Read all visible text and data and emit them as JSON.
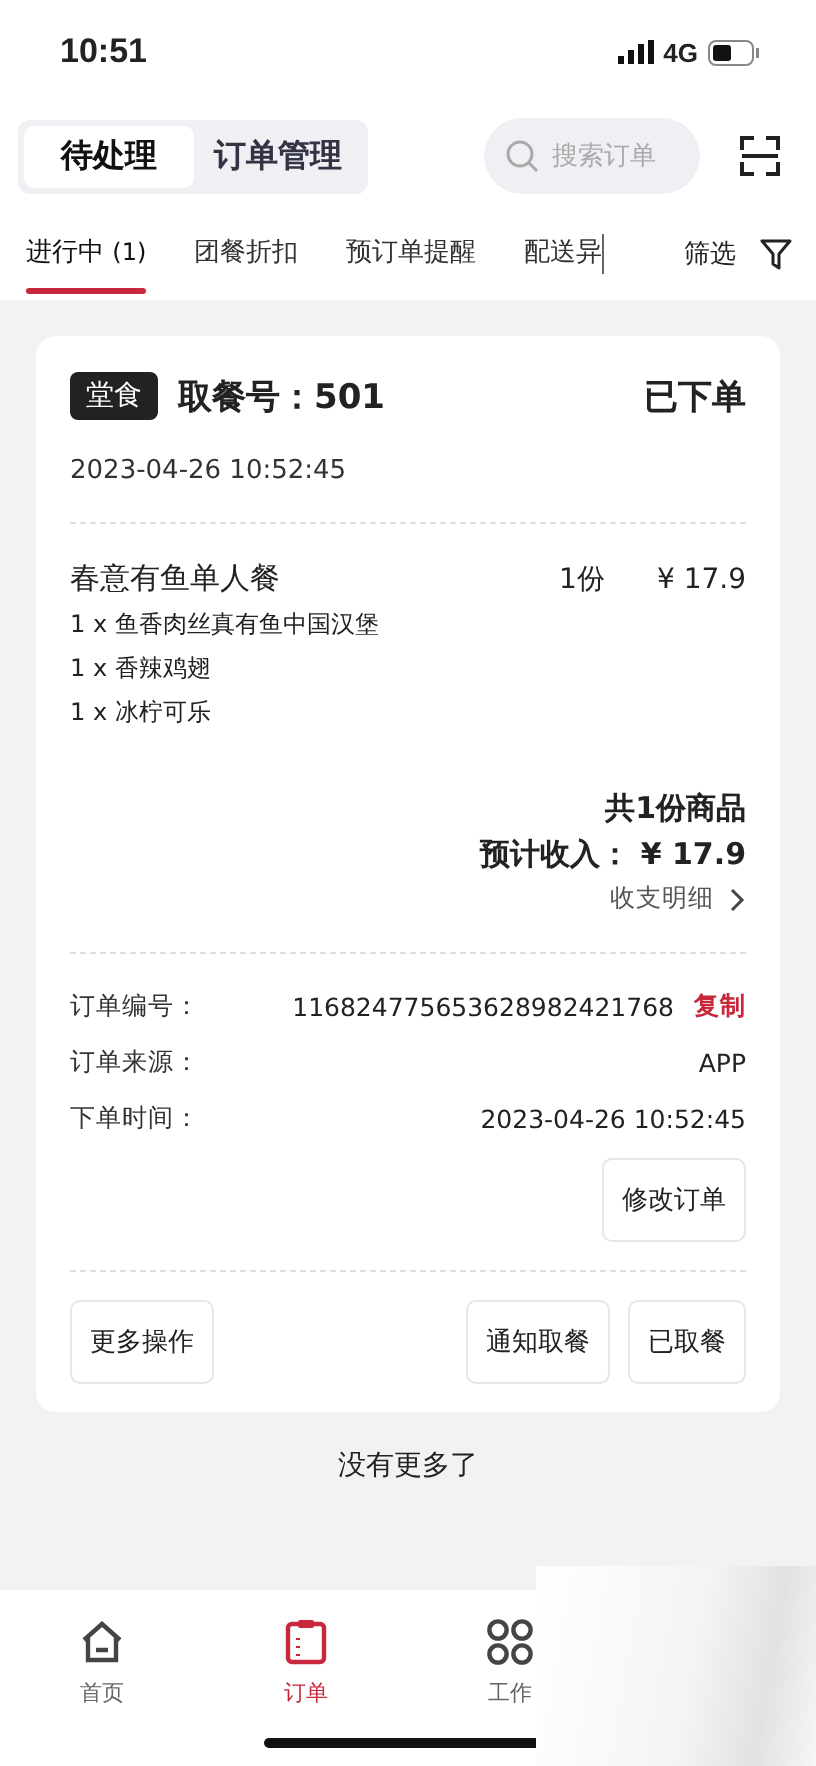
{
  "status_bar": {
    "time": "10:51",
    "network": "4G"
  },
  "segments": [
    {
      "label": "待处理",
      "selected": true
    },
    {
      "label": "订单管理",
      "selected": false
    }
  ],
  "search": {
    "placeholder": "搜索订单"
  },
  "filter_tabs": [
    {
      "label": "进行中",
      "count": "(1)",
      "selected": true
    },
    {
      "label": "团餐折扣",
      "selected": false
    },
    {
      "label": "预订单提醒",
      "selected": false
    },
    {
      "label": "配送异",
      "selected": false
    }
  ],
  "filter_button": "筛选",
  "order": {
    "type_badge": "堂食",
    "pickup": "取餐号：501",
    "status": "已下单",
    "created": "2023-04-26 10:52:45",
    "items": [
      {
        "name": "春意有鱼单人餐",
        "quantity": "1份",
        "price": "¥ 17.9",
        "components": [
          "1 x 鱼香肉丝真有鱼中国汉堡",
          "1 x 香辣鸡翅",
          "1 x 冰柠可乐"
        ]
      }
    ],
    "total_count": "共1份商品",
    "income": "预计收入： ¥ 17.9",
    "details_link": "收支明细",
    "info": [
      {
        "label": "订单编号：",
        "value": "116824775653628982421768",
        "action": "复制"
      },
      {
        "label": "订单来源：",
        "value": "APP"
      },
      {
        "label": "下单时间：",
        "value": "2023-04-26 10:52:45"
      }
    ],
    "edit_button": "修改订单",
    "more_button": "更多操作",
    "actions": [
      "通知取餐",
      "已取餐"
    ]
  },
  "footer_note": "没有更多了",
  "nav": [
    {
      "label": "首页",
      "kind": "home",
      "selected": false
    },
    {
      "label": "订单",
      "kind": "clipboard",
      "selected": true
    },
    {
      "label": "工作",
      "kind": "grid",
      "selected": false
    }
  ]
}
